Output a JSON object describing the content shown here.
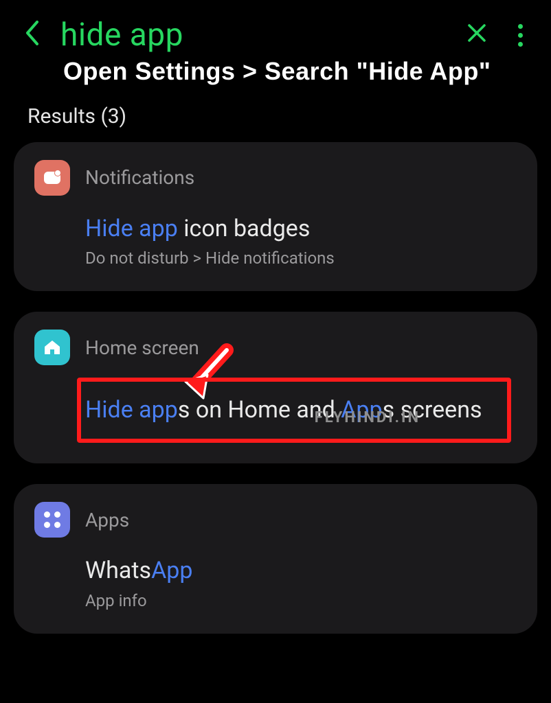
{
  "header": {
    "search_query": "hide app",
    "instruction": "Open Settings > Search \"Hide App\""
  },
  "results_label": "Results (3)",
  "cards": [
    {
      "icon": "notifications-icon",
      "title": "Notifications",
      "item_title_parts": {
        "highlight": "Hide app",
        "rest": " icon badges"
      },
      "item_sub": "Do not disturb > Hide notifications"
    },
    {
      "icon": "home-icon",
      "title": "Home screen",
      "item_title_parts": {
        "h1": "Hide app",
        "t1": "s on Home and ",
        "h2": "App",
        "t2": "s screens"
      },
      "watermark": "FLYHINDI.IN",
      "highlighted": true
    },
    {
      "icon": "apps-icon",
      "title": "Apps",
      "item_title_parts": {
        "t1": "Whats",
        "h1": "App"
      },
      "item_sub": "App info"
    }
  ]
}
